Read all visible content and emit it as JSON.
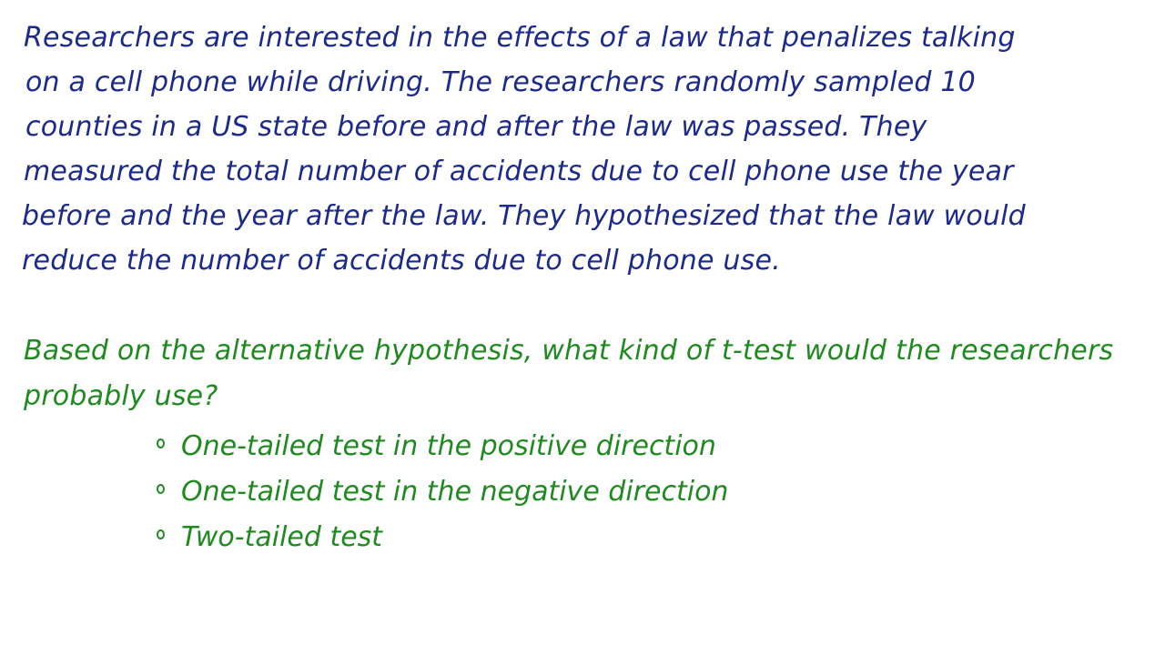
{
  "problem": {
    "lines": [
      "Researchers are interested in the effects of a law that penalizes talking",
      "on a cell phone while driving. The researchers randomly sampled 10",
      "counties in a US state before and after the law was passed. They",
      "measured the total number of accidents due to cell phone use the year",
      "before and the year after the law. They hypothesized that the law would",
      "reduce the number of accidents due to cell phone use."
    ]
  },
  "question": {
    "lines": [
      "Based on the alternative hypothesis, what kind of t-test would the researchers",
      "probably use?"
    ],
    "options": [
      "One-tailed test in the positive direction",
      "One-tailed test in the negative direction",
      "Two-tailed test"
    ]
  },
  "colors": {
    "problem_text": "#1b2a8c",
    "question_text": "#1f8a1f",
    "background": "#ffffff"
  }
}
